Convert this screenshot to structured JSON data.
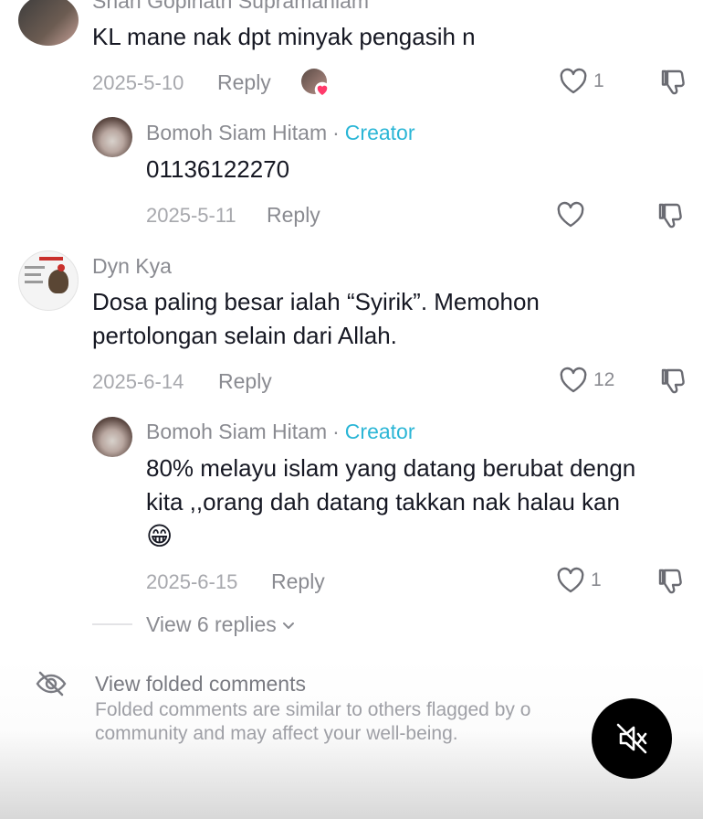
{
  "comments": [
    {
      "username": "Shah Gopinath Supramaniam",
      "text": "KL mane nak dpt minyak pengasih n",
      "date": "2025-5-10",
      "reply_label": "Reply",
      "likes": "1",
      "has_liker_avatar": true
    },
    {
      "username": "Bomoh Siam Hitam",
      "separator": "·",
      "badge": "Creator",
      "text": "01136122270",
      "date": "2025-5-11",
      "reply_label": "Reply",
      "likes": ""
    },
    {
      "username": "Dyn Kya",
      "text_line1": "Dosa paling besar ialah “Syirik”. Memohon",
      "text_line2": "pertolongan selain dari Allah.",
      "date": "2025-6-14",
      "reply_label": "Reply",
      "likes": "12"
    },
    {
      "username": "Bomoh Siam Hitam",
      "separator": "·",
      "badge": "Creator",
      "text_line1": "80% melayu islam yang datang berubat dengn",
      "text_line2": "kita ,,orang dah datang takkan nak halau kan",
      "emoji": "😁",
      "date": "2025-6-15",
      "reply_label": "Reply",
      "likes": "1"
    }
  ],
  "view_replies": "View 6 replies",
  "folded": {
    "title": "View folded comments",
    "desc_line1": "Folded comments are similar to others flagged by o",
    "desc_line2": "community and may affect your well-being."
  },
  "colors": {
    "creator": "#2bb6d6",
    "muted_text": "#8a8b91",
    "heart_pink": "#ff3b6b"
  },
  "icons": [
    "heart-icon",
    "thumbs-down-icon",
    "eye-off-icon",
    "mute-icon",
    "chevron-down-icon"
  ]
}
